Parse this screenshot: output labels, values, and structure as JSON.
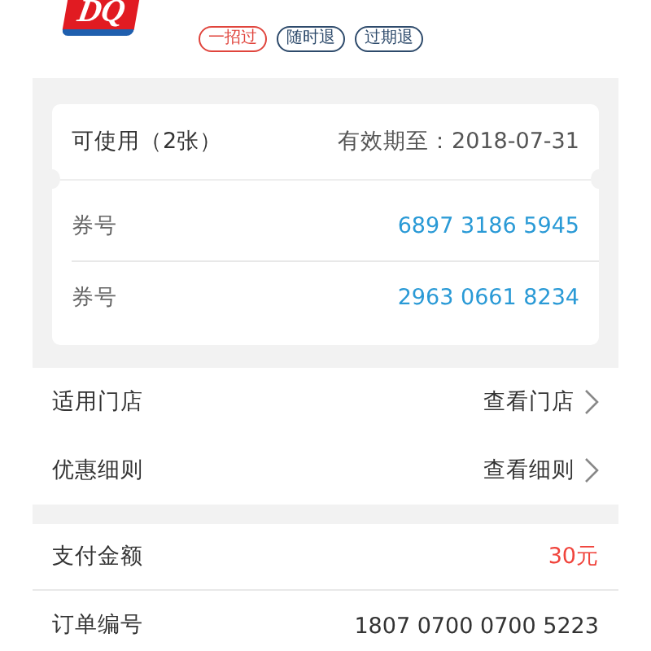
{
  "logo": {
    "text": "DQ"
  },
  "tags": [
    {
      "label": "一招过",
      "color": "#e0443c"
    },
    {
      "label": "随时退",
      "color": "#2d4a6b"
    },
    {
      "label": "过期退",
      "color": "#2d4a6b"
    }
  ],
  "coupon_card": {
    "available": "可使用（2张）",
    "expiry": "有效期至：2018-07-31",
    "codes": [
      {
        "label": "券号",
        "value": "6897 3186 5945"
      },
      {
        "label": "券号",
        "value": "2963 0661 8234"
      }
    ]
  },
  "store_rows": [
    {
      "label": "适用门店",
      "link": "查看门店"
    },
    {
      "label": "优惠细则",
      "link": "查看细则"
    }
  ],
  "order_rows": [
    {
      "label": "支付金额",
      "value": "30元",
      "kind": "amount"
    },
    {
      "label": "订单编号",
      "value": "1807 0700 0700 5223",
      "kind": "plain"
    }
  ]
}
